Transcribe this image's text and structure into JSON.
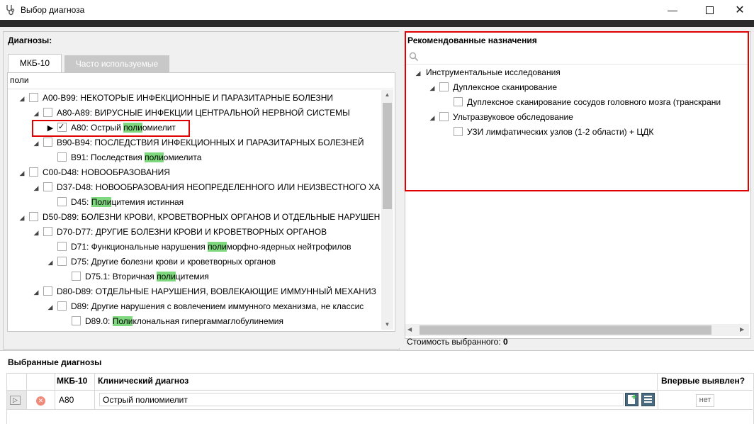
{
  "window": {
    "title": "Выбор диагноза",
    "icon": "stethoscope-icon"
  },
  "left": {
    "header": "Диагнозы:",
    "tabs": [
      {
        "label": "МКБ-10",
        "active": true
      },
      {
        "label": "Часто используемые",
        "active": false
      }
    ],
    "search_value": "поли",
    "tree": [
      {
        "level": 0,
        "expander": "open",
        "checked": false,
        "pre": "A00-B99: НЕКОТОРЫЕ ИНФЕКЦИОННЫЕ И ПАРАЗИТАРНЫЕ БОЛЕЗНИ",
        "hl": "",
        "post": ""
      },
      {
        "level": 1,
        "expander": "open",
        "checked": false,
        "pre": "A80-A89: ВИРУСНЫЕ ИНФЕКЦИИ ЦЕНТРАЛЬНОЙ НЕРВНОЙ СИСТЕМЫ",
        "hl": "",
        "post": ""
      },
      {
        "level": 2,
        "expander": "closed",
        "checked": true,
        "pre": "A80: Острый ",
        "hl": "поли",
        "post": "омиелит",
        "highlighted_box": true
      },
      {
        "level": 1,
        "expander": "open",
        "checked": false,
        "pre": "B90-B94: ПОСЛЕДСТВИЯ ИНФЕКЦИОННЫХ И ПАРАЗИТАРНЫХ БОЛЕЗНЕЙ",
        "hl": "",
        "post": ""
      },
      {
        "level": 2,
        "expander": "none",
        "checked": false,
        "pre": "B91: Последствия ",
        "hl": "поли",
        "post": "омиелита"
      },
      {
        "level": 0,
        "expander": "open",
        "checked": false,
        "pre": "C00-D48: НОВООБРАЗОВАНИЯ",
        "hl": "",
        "post": ""
      },
      {
        "level": 1,
        "expander": "open",
        "checked": false,
        "pre": "D37-D48: НОВООБРАЗОВАНИЯ НЕОПРЕДЕЛЕННОГО ИЛИ НЕИЗВЕСТНОГО ХА",
        "hl": "",
        "post": ""
      },
      {
        "level": 2,
        "expander": "none",
        "checked": false,
        "pre": "D45: ",
        "hl": "Поли",
        "post": "цитемия истинная"
      },
      {
        "level": 0,
        "expander": "open",
        "checked": false,
        "pre": "D50-D89: БОЛЕЗНИ КРОВИ, КРОВЕТВОРНЫХ ОРГАНОВ И ОТДЕЛЬНЫЕ НАРУШЕН",
        "hl": "",
        "post": ""
      },
      {
        "level": 1,
        "expander": "open",
        "checked": false,
        "pre": "D70-D77: ДРУГИЕ БОЛЕЗНИ КРОВИ И КРОВЕТВОРНЫХ ОРГАНОВ",
        "hl": "",
        "post": ""
      },
      {
        "level": 2,
        "expander": "none",
        "checked": false,
        "pre": "D71: Функциональные нарушения ",
        "hl": "поли",
        "post": "морфно-ядерных нейтрофилов"
      },
      {
        "level": 2,
        "expander": "open",
        "checked": false,
        "pre": "D75: Другие болезни крови и кроветворных органов",
        "hl": "",
        "post": ""
      },
      {
        "level": 3,
        "expander": "none",
        "checked": false,
        "pre": "D75.1: Вторичная ",
        "hl": "поли",
        "post": "цитемия"
      },
      {
        "level": 1,
        "expander": "open",
        "checked": false,
        "pre": "D80-D89: ОТДЕЛЬНЫЕ НАРУШЕНИЯ, ВОВЛЕКАЮЩИЕ ИММУННЫЙ МЕХАНИЗ",
        "hl": "",
        "post": ""
      },
      {
        "level": 2,
        "expander": "open",
        "checked": false,
        "pre": "D89: Другие нарушения с вовлечением иммунного механизма, не классис",
        "hl": "",
        "post": ""
      },
      {
        "level": 3,
        "expander": "none",
        "checked": false,
        "pre": "D89.0: ",
        "hl": "Поли",
        "post": "клональная гипергаммаглобулинемия"
      }
    ]
  },
  "right": {
    "header": "Рекомендованные назначения",
    "tree": [
      {
        "level": 0,
        "expander": "open",
        "checkbox": false,
        "label": "Инструментальные исследования"
      },
      {
        "level": 1,
        "expander": "open",
        "checkbox": true,
        "label": "Дуплексное сканирование"
      },
      {
        "level": 2,
        "expander": "none",
        "checkbox": true,
        "label": "Дуплексное сканирование сосудов головного мозга (транскрани"
      },
      {
        "level": 1,
        "expander": "open",
        "checkbox": true,
        "label": "Ультразвуковое обследование"
      },
      {
        "level": 2,
        "expander": "none",
        "checkbox": true,
        "label": "УЗИ лимфатических узлов (1-2 области) + ЦДК"
      }
    ],
    "cost_label": "Стоимость выбранного:",
    "cost_value": "0"
  },
  "selected": {
    "header": "Выбранные диагнозы",
    "columns": {
      "code": "МКБ-10",
      "clinical": "Клинический диагноз",
      "first": "Впервые выявлен?"
    },
    "rows": [
      {
        "code": "A80",
        "clinical": "Острый полиомиелит",
        "first": "нет"
      }
    ]
  },
  "colors": {
    "highlight": "#7ed87e",
    "red_box": "#e00000"
  }
}
